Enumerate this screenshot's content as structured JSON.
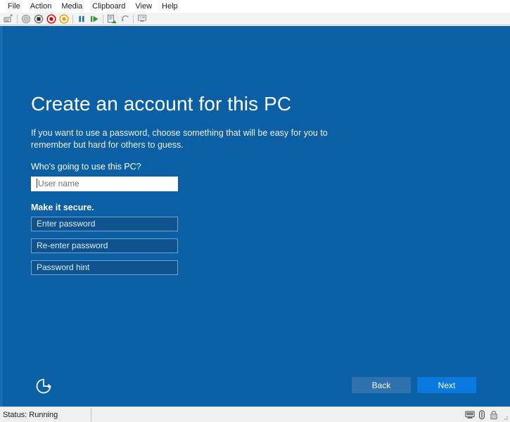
{
  "window": {
    "menubar": {
      "items": [
        {
          "label": "File",
          "name": "menu-file"
        },
        {
          "label": "Action",
          "name": "menu-action"
        },
        {
          "label": "Media",
          "name": "menu-media"
        },
        {
          "label": "Clipboard",
          "name": "menu-clipboard"
        },
        {
          "label": "View",
          "name": "menu-view"
        },
        {
          "label": "Help",
          "name": "menu-help"
        }
      ]
    },
    "toolbar": {
      "buttons": [
        {
          "icon": "ctrl-alt-del-icon",
          "title": "Ctrl+Alt+Delete"
        },
        {
          "icon": "turn-off-icon",
          "title": "Turn Off"
        },
        {
          "icon": "shut-down-icon",
          "title": "Shut Down"
        },
        {
          "icon": "save-state-icon",
          "title": "Save"
        },
        {
          "icon": "revert-icon",
          "title": "Revert"
        },
        {
          "icon": "pause-icon",
          "title": "Pause"
        },
        {
          "icon": "start-icon",
          "title": "Start"
        },
        {
          "icon": "checkpoint-icon",
          "title": "Checkpoint"
        },
        {
          "icon": "revert-arrow-icon",
          "title": "Revert"
        },
        {
          "icon": "enhanced-session-icon",
          "title": "Enhanced Session"
        }
      ]
    }
  },
  "oobe": {
    "title": "Create an account for this PC",
    "subtitle": "If you want to use a password, choose something that will be easy for you to remember but hard for others to guess.",
    "who_label": "Who's going to use this PC?",
    "secure_label": "Make it secure.",
    "fields": {
      "username": {
        "placeholder": "User name",
        "value": ""
      },
      "password": {
        "placeholder": "Enter password",
        "value": ""
      },
      "password_confirm": {
        "placeholder": "Re-enter password",
        "value": ""
      },
      "password_hint": {
        "placeholder": "Password hint",
        "value": ""
      }
    },
    "ease_of_access_icon": "ease-of-access-icon",
    "buttons": {
      "back": "Back",
      "next": "Next"
    },
    "colors": {
      "background": "#0b5fa5",
      "next_button": "#0a79df",
      "back_button": "#2d72ac",
      "field_border": "#6fa4cf"
    }
  },
  "statusbar": {
    "status": "Status: Running",
    "icons": [
      {
        "name": "display-icon"
      },
      {
        "name": "usb-device-icon"
      },
      {
        "name": "lock-icon"
      }
    ]
  }
}
